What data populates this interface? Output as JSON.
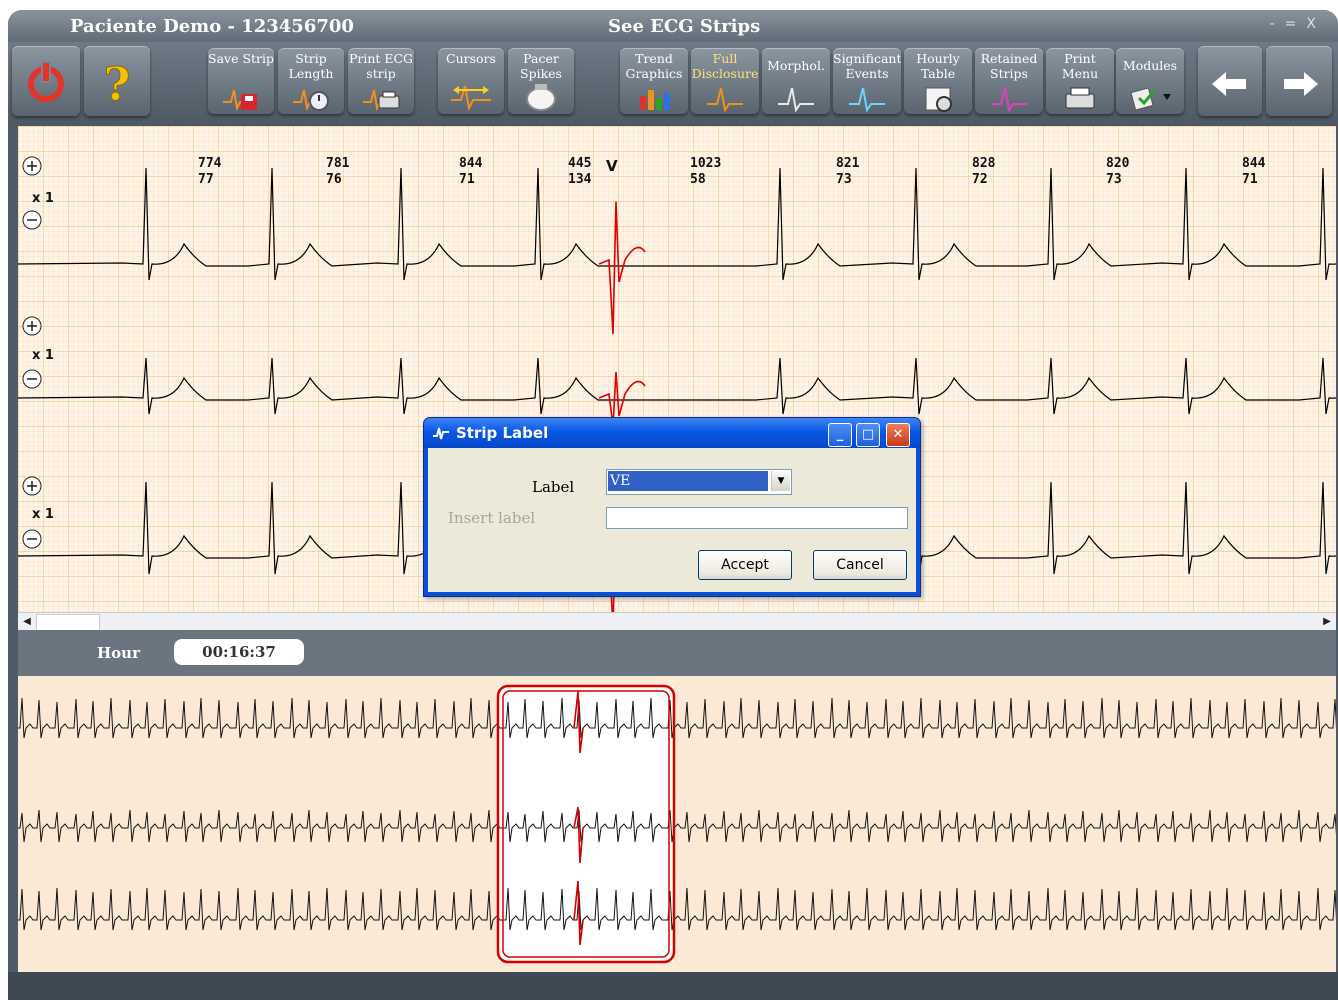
{
  "window": {
    "title_left": "Paciente Demo - 123456700",
    "title_center": "See ECG Strips",
    "controls": [
      "-",
      "=",
      "X"
    ]
  },
  "toolbar": {
    "power": "power-icon",
    "help": "help-icon",
    "buttons": [
      {
        "label": "Save Strip",
        "icon": "save-strip-icon"
      },
      {
        "label": "Strip\nLength",
        "icon": "strip-length-icon"
      },
      {
        "label": "Print ECG\nstrip",
        "icon": "print-ecg-icon"
      },
      {
        "label": "Cursors",
        "icon": "cursors-icon"
      },
      {
        "label": "Pacer\nSpikes",
        "icon": "pacer-spikes-icon"
      },
      {
        "label": "Trend\nGraphics",
        "icon": "trend-graphics-icon"
      },
      {
        "label": "Full\nDisclosure",
        "icon": "full-disclosure-icon"
      },
      {
        "label": "Morphol.",
        "icon": "morphology-icon"
      },
      {
        "label": "Significant\nEvents",
        "icon": "significant-events-icon"
      },
      {
        "label": "Hourly\nTable",
        "icon": "hourly-table-icon"
      },
      {
        "label": "Retained\nStrips",
        "icon": "retained-strips-icon"
      },
      {
        "label": "Print\nMenu",
        "icon": "print-menu-icon"
      },
      {
        "label": "Modules",
        "icon": "modules-icon"
      }
    ],
    "back": "back-arrow-icon",
    "forward": "forward-arrow-icon"
  },
  "ecg": {
    "channel_gain": [
      "x 1",
      "x 1",
      "x 1"
    ],
    "beat_marker": "V",
    "intervals": [
      {
        "rr": "774",
        "hr": "77"
      },
      {
        "rr": "781",
        "hr": "76"
      },
      {
        "rr": "844",
        "hr": "71"
      },
      {
        "rr": "445",
        "hr": "134"
      },
      {
        "rr": "1023",
        "hr": "58"
      },
      {
        "rr": "821",
        "hr": "73"
      },
      {
        "rr": "828",
        "hr": "72"
      },
      {
        "rr": "820",
        "hr": "73"
      },
      {
        "rr": "844",
        "hr": "71"
      }
    ],
    "grid_color": "#f7c58a",
    "trace_color": "#000000",
    "highlight_color": "#e00000"
  },
  "hour": {
    "label": "Hour",
    "value": "00:16:37"
  },
  "dialog": {
    "title": "Strip Label",
    "label_text": "Label",
    "selected": "VE",
    "insert_label": "Insert label",
    "insert_value": "",
    "accept": "Accept",
    "cancel": "Cancel"
  },
  "colors": {
    "toolbar": "#5a6570",
    "overview_bg": "#fbe9d5",
    "selection": "#d40000"
  }
}
